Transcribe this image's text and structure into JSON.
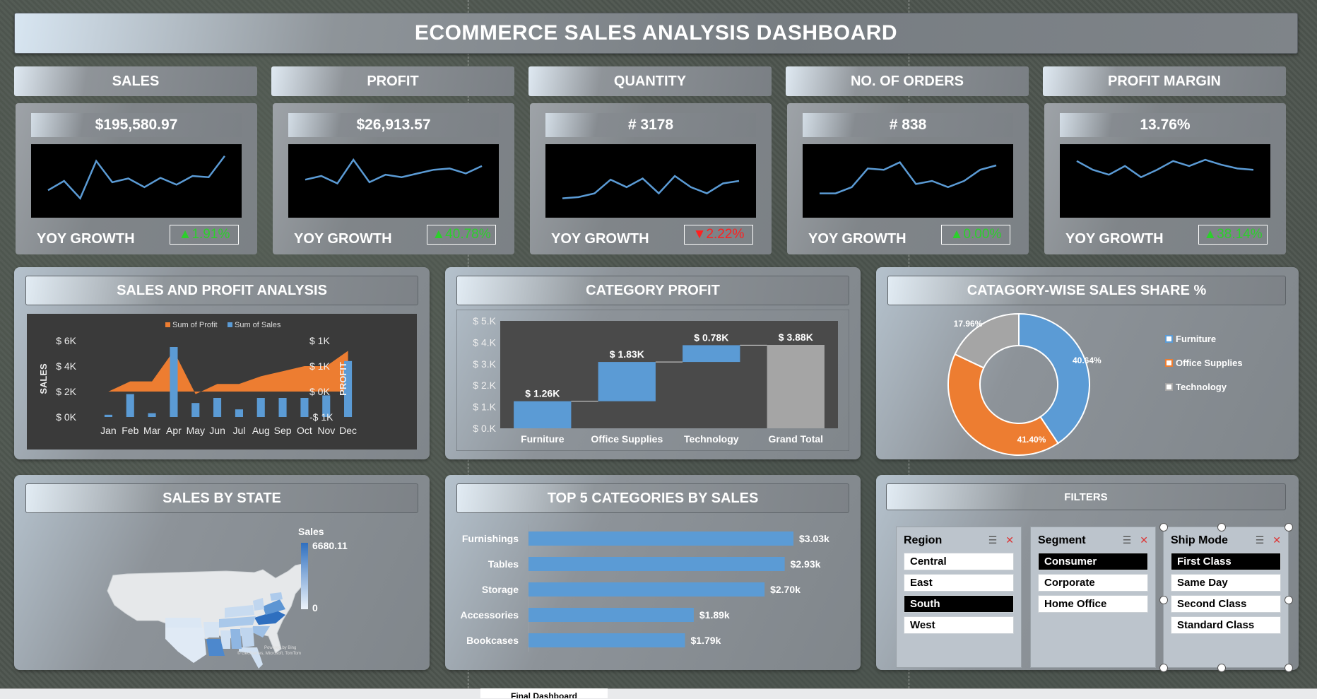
{
  "title": "ECOMMERCE SALES ANALYSIS DASHBOARD",
  "kpis": [
    {
      "label": "SALES",
      "value": "$195,580.97",
      "yoy_label": "YOY GROWTH",
      "yoy": "▲1.91%",
      "dir": "up",
      "spark": [
        35,
        50,
        22,
        82,
        48,
        54,
        40,
        55,
        44,
        58,
        56,
        90
      ]
    },
    {
      "label": "PROFIT",
      "value": "$26,913.57",
      "yoy_label": "YOY GROWTH",
      "yoy": "▲40.78%",
      "dir": "up",
      "spark": [
        52,
        58,
        46,
        84,
        48,
        60,
        56,
        62,
        68,
        70,
        62,
        74
      ]
    },
    {
      "label": "QUANTITY",
      "value": "# 3178",
      "yoy_label": "YOY GROWTH",
      "yoy": "▼2.22%",
      "dir": "down",
      "spark": [
        22,
        24,
        30,
        52,
        40,
        54,
        30,
        58,
        40,
        30,
        46,
        50
      ]
    },
    {
      "label": "NO. OF ORDERS",
      "value": "# 838",
      "yoy_label": "YOY GROWTH",
      "yoy": "▲0.00%",
      "dir": "up",
      "spark": [
        30,
        30,
        40,
        70,
        68,
        80,
        45,
        50,
        40,
        50,
        68,
        75
      ]
    },
    {
      "label": "PROFIT MARGIN",
      "value": "13.76%",
      "yoy_label": "YOY GROWTH",
      "yoy": "▲38.14%",
      "dir": "up",
      "spark": [
        82,
        68,
        60,
        74,
        56,
        68,
        82,
        74,
        84,
        76,
        70,
        68
      ]
    }
  ],
  "panels": {
    "sales_profit": "SALES AND PROFIT ANALYSIS",
    "category_profit": "CATEGORY PROFIT",
    "category_share": "CATAGORY-WISE SALES SHARE %",
    "sales_state": "SALES BY STATE",
    "top5": "TOP 5 CATEGORIES BY SALES",
    "filters": "FILTERS"
  },
  "chart_data": [
    {
      "type": "bar",
      "categories": [
        "Jan",
        "Feb",
        "Mar",
        "Apr",
        "May",
        "Jun",
        "Jul",
        "Aug",
        "Sep",
        "Oct",
        "Nov",
        "Dec"
      ],
      "series": [
        {
          "name": "Sum of Sales",
          "values": [
            180,
            1800,
            300,
            5500,
            1100,
            1500,
            600,
            1500,
            1500,
            1500,
            1700,
            4400
          ]
        },
        {
          "name": "Sum of Profit",
          "values": [
            0,
            200,
            200,
            800,
            -50,
            150,
            150,
            300,
            400,
            500,
            500,
            800
          ]
        }
      ],
      "legend": [
        "Sum of Profit",
        "Sum of Sales"
      ],
      "ylabel": "SALES",
      "y2label": "PROFIT",
      "y_ticks": [
        "$ 6K",
        "$ 4K",
        "$ 2K",
        "$ 0K"
      ],
      "y2_ticks": [
        "$ 1K",
        "$ 1K",
        "$ 0K",
        "-$ 1K"
      ],
      "ylim": [
        0,
        6000
      ],
      "y2lim": [
        -500,
        1000
      ]
    },
    {
      "type": "bar",
      "categories": [
        "Furniture",
        "Office Supplies",
        "Technology",
        "Grand Total"
      ],
      "values": [
        1.26,
        1.83,
        0.78,
        3.88
      ],
      "labels": [
        "$ 1.26K",
        "$ 1.83K",
        "$ 0.78K",
        "$ 3.88K"
      ],
      "y_ticks": [
        "$ 5.K",
        "$ 4.K",
        "$ 3.K",
        "$ 2.K",
        "$ 1.K",
        "$ 0.K"
      ],
      "ylim": [
        0,
        5
      ]
    },
    {
      "type": "pie",
      "categories": [
        "Furniture",
        "Office Supplies",
        "Technology"
      ],
      "values": [
        40.64,
        41.4,
        17.96
      ],
      "labels": [
        "40.64%",
        "41.40%",
        "17.96%"
      ],
      "colors": [
        "#5b9bd5",
        "#ed7d31",
        "#a5a5a5"
      ]
    },
    {
      "type": "bar",
      "categories": [
        "Furnishings",
        "Tables",
        "Storage",
        "Accessories",
        "Bookcases"
      ],
      "values": [
        3.03,
        2.93,
        2.7,
        1.89,
        1.79
      ],
      "labels": [
        "$3.03k",
        "$2.93k",
        "$2.70k",
        "$1.89k",
        "$1.79k"
      ]
    }
  ],
  "map": {
    "legend_title": "Sales",
    "legend_max": "6680.11",
    "legend_min": "0",
    "credit_1": "Powered by Bing",
    "credit_2": "© GeoNames, Microsoft, TomTom"
  },
  "filters": {
    "region": {
      "title": "Region",
      "items": [
        "Central",
        "East",
        "South",
        "West"
      ],
      "selected": [
        "South"
      ]
    },
    "segment": {
      "title": "Segment",
      "items": [
        "Consumer",
        "Corporate",
        "Home Office"
      ],
      "selected": [
        "Consumer"
      ]
    },
    "ship": {
      "title": "Ship Mode",
      "items": [
        "First Class",
        "Same Day",
        "Second Class",
        "Standard Class"
      ],
      "selected": [
        "First Class"
      ]
    }
  },
  "sheet_tab": "Final Dashboard",
  "colors": {
    "sales": "#5b9bd5",
    "profit": "#ed7d31",
    "up": "#2ccf2c",
    "down": "#ff2020"
  }
}
